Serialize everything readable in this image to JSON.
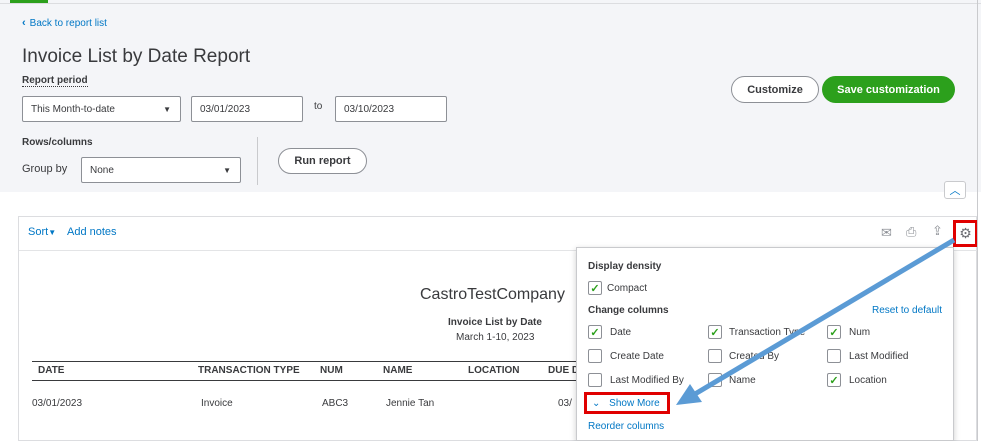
{
  "nav": {
    "back_label": "Back to report list"
  },
  "report": {
    "title": "Invoice List by Date Report",
    "period_label": "Report period",
    "period_value": "This Month-to-date",
    "from_date": "03/01/2023",
    "to_label": "to",
    "to_date": "03/10/2023",
    "rows_columns_label": "Rows/columns",
    "group_by_label": "Group by",
    "group_by_value": "None",
    "run_report": "Run report",
    "customize": "Customize",
    "save_customization": "Save customization"
  },
  "toolbar": {
    "sort": "Sort",
    "add_notes": "Add notes",
    "icons": [
      "email-icon",
      "print-icon",
      "export-icon",
      "gear-icon"
    ]
  },
  "report_body": {
    "company": "CastroTestCompany",
    "title": "Invoice List by Date",
    "date_range": "March 1-10, 2023",
    "columns": [
      "DATE",
      "TRANSACTION TYPE",
      "NUM",
      "NAME",
      "LOCATION",
      "DUE D"
    ],
    "rows": [
      [
        "03/01/2023",
        "Invoice",
        "ABC3",
        "Jennie Tan",
        "",
        "03/"
      ]
    ]
  },
  "panel": {
    "display_density_label": "Display density",
    "compact_label": "Compact",
    "compact_checked": true,
    "change_columns_label": "Change columns",
    "reset_label": "Reset to default",
    "columns": [
      {
        "label": "Date",
        "checked": true
      },
      {
        "label": "Transaction Type",
        "checked": true
      },
      {
        "label": "Num",
        "checked": true
      },
      {
        "label": "Create Date",
        "checked": false
      },
      {
        "label": "Created By",
        "checked": false
      },
      {
        "label": "Last Modified",
        "checked": false
      },
      {
        "label": "Last Modified By",
        "checked": false
      },
      {
        "label": "Name",
        "checked": false
      },
      {
        "label": "Location",
        "checked": true
      }
    ],
    "show_more": "Show More",
    "reorder": "Reorder columns"
  },
  "colors": {
    "accent_green": "#2ca01c",
    "link_blue": "#0077c5",
    "highlight_red": "#e00000",
    "arrow_blue": "#5b9bd5"
  }
}
